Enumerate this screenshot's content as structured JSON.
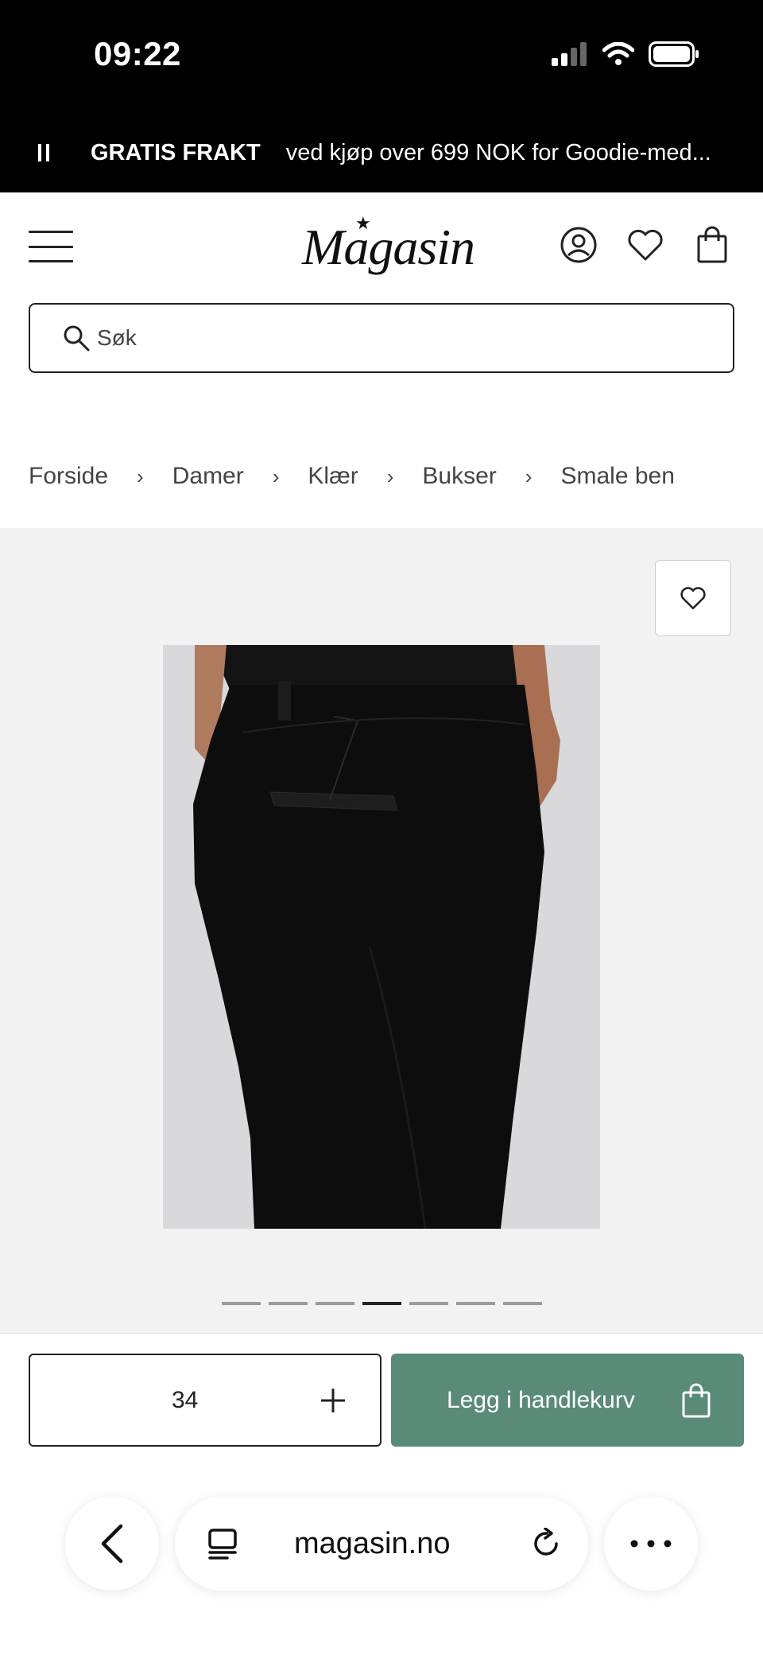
{
  "status_bar": {
    "time": "09:22"
  },
  "promo": {
    "strong": "GRATIS FRAKT",
    "text": "ved kjøp over 699 NOK for Goodie-med..."
  },
  "header": {
    "logo": "Magasin"
  },
  "search": {
    "placeholder": "Søk"
  },
  "breadcrumb": {
    "items": [
      "Forside",
      "Damer",
      "Klær",
      "Bukser",
      "Smale ben"
    ],
    "separator": "›"
  },
  "gallery": {
    "image_count": 7,
    "active_index": 3
  },
  "action_bar": {
    "size": "34",
    "add_to_cart": "Legg i handlekurv",
    "accent_color": "#5a8a78"
  },
  "browser": {
    "url": "magasin.no"
  }
}
